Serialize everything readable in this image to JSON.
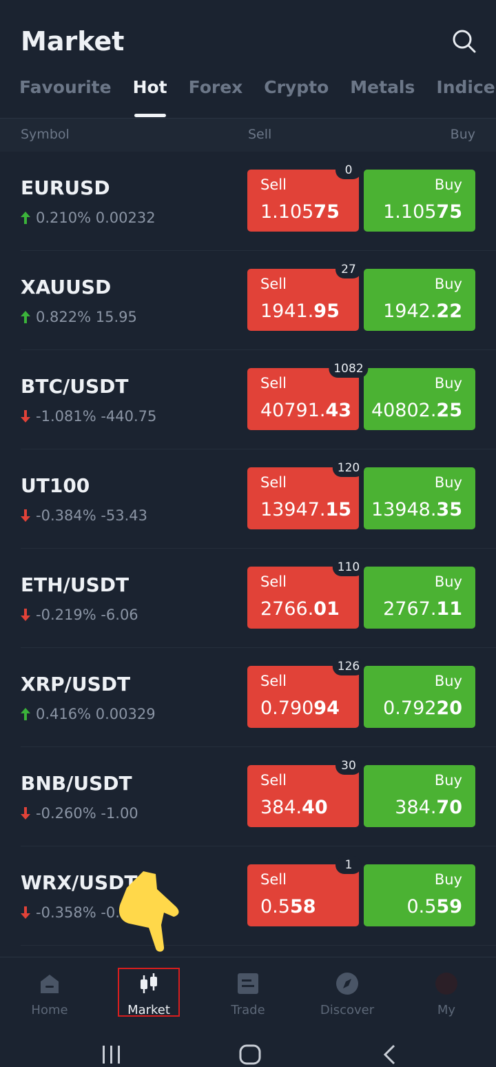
{
  "header": {
    "title": "Market"
  },
  "tabs": [
    {
      "label": "Favourite",
      "active": false
    },
    {
      "label": "Hot",
      "active": true
    },
    {
      "label": "Forex",
      "active": false
    },
    {
      "label": "Crypto",
      "active": false
    },
    {
      "label": "Metals",
      "active": false
    },
    {
      "label": "Indices",
      "active": false
    }
  ],
  "columns": {
    "symbol": "Symbol",
    "sell": "Sell",
    "buy": "Buy"
  },
  "labels": {
    "sell": "Sell",
    "buy": "Buy"
  },
  "rows": [
    {
      "symbol": "EURUSD",
      "direction": "up",
      "change": "0.210%  0.00232",
      "spread": "0",
      "sell_main": "1.105",
      "sell_big": "75",
      "buy_main": "1.105",
      "buy_big": "75"
    },
    {
      "symbol": "XAUUSD",
      "direction": "up",
      "change": "0.822%  15.95",
      "spread": "27",
      "sell_main": "1941.",
      "sell_big": "95",
      "buy_main": "1942.",
      "buy_big": "22"
    },
    {
      "symbol": "BTC/USDT",
      "direction": "down",
      "change": "-1.081%  -440.75",
      "spread": "1082",
      "sell_main": "40791.",
      "sell_big": "43",
      "buy_main": "40802.",
      "buy_big": "25"
    },
    {
      "symbol": "UT100",
      "direction": "down",
      "change": "-0.384%  -53.43",
      "spread": "120",
      "sell_main": "13947.",
      "sell_big": "15",
      "buy_main": "13948.",
      "buy_big": "35"
    },
    {
      "symbol": "ETH/USDT",
      "direction": "down",
      "change": "-0.219%  -6.06",
      "spread": "110",
      "sell_main": "2766.",
      "sell_big": "01",
      "buy_main": "2767.",
      "buy_big": "11"
    },
    {
      "symbol": "XRP/USDT",
      "direction": "up",
      "change": "0.416%  0.00329",
      "spread": "126",
      "sell_main": "0.790",
      "sell_big": "94",
      "buy_main": "0.792",
      "buy_big": "20"
    },
    {
      "symbol": "BNB/USDT",
      "direction": "down",
      "change": "-0.260%  -1.00",
      "spread": "30",
      "sell_main": "384.",
      "sell_big": "40",
      "buy_main": "384.",
      "buy_big": "70"
    },
    {
      "symbol": "WRX/USDT",
      "direction": "down",
      "change": "-0.358%  -0.",
      "spread": "1",
      "sell_main": "0.5",
      "sell_big": "58",
      "buy_main": "0.5",
      "buy_big": "59"
    }
  ],
  "bottom_nav": [
    {
      "label": "Home",
      "icon": "home-icon",
      "active": false
    },
    {
      "label": "Market",
      "icon": "candlestick-icon",
      "active": true
    },
    {
      "label": "Trade",
      "icon": "document-icon",
      "active": false
    },
    {
      "label": "Discover",
      "icon": "compass-icon",
      "active": false
    },
    {
      "label": "My",
      "icon": "profile-icon",
      "active": false
    }
  ],
  "colors": {
    "background": "#1b2330",
    "sell": "#e14238",
    "buy": "#4bb233",
    "up": "#3bb33a",
    "down": "#e14238"
  }
}
